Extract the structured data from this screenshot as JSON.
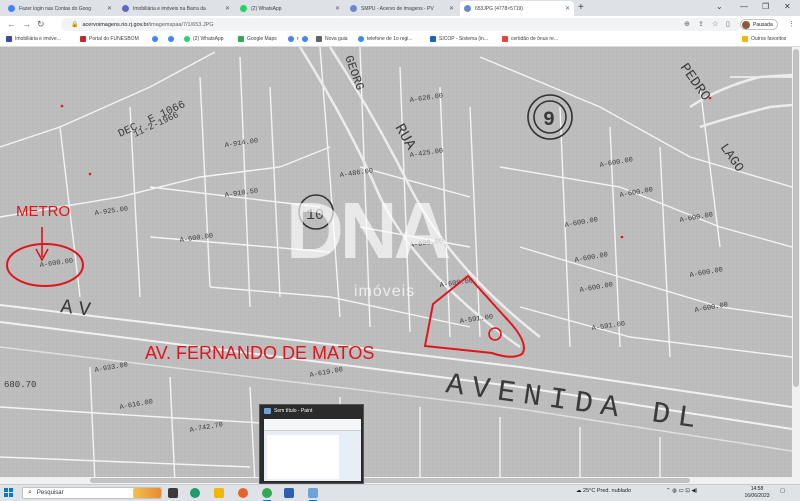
{
  "tabs": [
    {
      "label": "Fazer login nas Contas do Goog",
      "color": "#4285f4"
    },
    {
      "label": "Imobiliária e imóveis na Barra da",
      "color": "#5c6bc0"
    },
    {
      "label": "(2) WhatsApp",
      "color": "#25d366"
    },
    {
      "label": "SMPU - Acervo de Imagens - PV",
      "color": "#6a89cc"
    },
    {
      "label": "653JPG (4778×5719)",
      "color": "#6a89cc",
      "active": true
    }
  ],
  "address": {
    "host": "acervoimagens.rio.rj.gov.br",
    "path": "/imagemspaa/7/1/653.JPG"
  },
  "profile": {
    "label": "Pausada"
  },
  "bookmarks": [
    {
      "label": "Imobiliária e imóve...",
      "color": "#3949ab"
    },
    {
      "label": "Portal do FUNESBOM",
      "color": "#c62828"
    },
    {
      "label": "",
      "color": "#4285f4"
    },
    {
      "label": "",
      "color": "#4285f4"
    },
    {
      "label": "(2) WhatsApp",
      "color": "#25d366"
    },
    {
      "label": "Google Maps",
      "color": "#34a853"
    },
    {
      "label": "r",
      "color": "#4285f4"
    },
    {
      "label": "",
      "color": "#4285f4"
    },
    {
      "label": "Nova guia",
      "color": "#5f6368"
    },
    {
      "label": "telefone de 1o regi...",
      "color": "#4285f4"
    },
    {
      "label": "SICOP - Sistema (in...",
      "color": "#1565c0"
    },
    {
      "label": "certidão de ônus re...",
      "color": "#ea4335"
    }
  ],
  "other_bookmarks": "Outros favoritos",
  "map": {
    "annotations": {
      "metro": "METRO",
      "avenue": "AV. FERNANDO DE MATOS"
    },
    "watermark": {
      "brand": "DNA",
      "sub": "imóveis"
    },
    "street_labels": {
      "rua_top": "RUA",
      "rua_geor": "GEORG",
      "pedro": "PEDRO",
      "lago": "LAGO",
      "avenida": "AVENIDA DL",
      "dec": "DEC. E 1066",
      "dec2": "11-2-1966",
      "av_partial": "AV",
      "block": "9",
      "block2": "10"
    },
    "lot_labels": [
      "A-628.00",
      "A-914.00",
      "A-486.00",
      "A-425.00",
      "A-600.00",
      "A-600.00",
      "A-925.00",
      "A-600.00",
      "A-600.00",
      "A-600.00",
      "A-600.00",
      "A-600.00",
      "A-600.00",
      "A-591.00",
      "A-933.00",
      "A-619.00",
      "A-616.00",
      "A-742.70",
      "680.70",
      "A-600.00",
      "A-600.00",
      "A-600.00",
      "A-910.50",
      "A-600.00",
      "A-591.00"
    ]
  },
  "paint_preview": {
    "title": "Sem título - Paint"
  },
  "taskbar": {
    "search_placeholder": "Pesquisar",
    "weather": "25°C  Pred. nublado",
    "time": "14:58",
    "date": "16/06/2023"
  },
  "colors": {
    "annotation_red": "#e0151b",
    "map_gray": "#bdbdbd"
  }
}
